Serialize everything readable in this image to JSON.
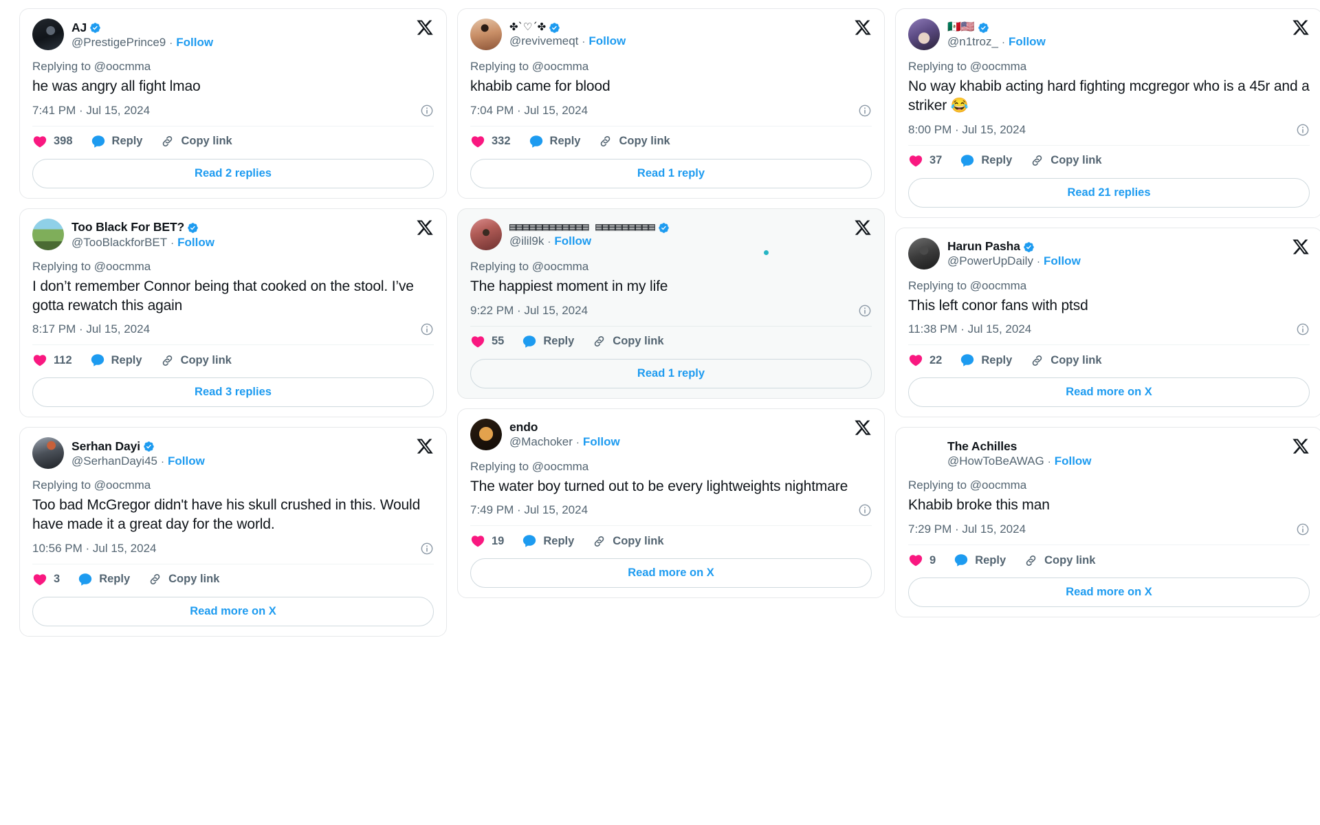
{
  "theme": {
    "accent_blue": "#1d9bf0",
    "like_pink": "#f91880",
    "reply_blue": "#1d9bf0",
    "text_primary": "#0f1419",
    "text_secondary": "#536471",
    "card_border": "#e6e8ea",
    "tinted_card_bg": "#f7f9f9",
    "verified_badge": "#1d9bf0"
  },
  "labels": {
    "replying_to": "Replying to @oocmma",
    "follow": "Follow",
    "reply": "Reply",
    "copy_link": "Copy link",
    "separator": "·"
  },
  "columns": [
    {
      "id": "column-1",
      "cards": [
        {
          "id": "card-prestigeprince9",
          "display_name": "AJ",
          "name_style": "plain",
          "verified": true,
          "has_avatar": true,
          "avatar_class": "av-aj",
          "handle": "@PrestigePrince9",
          "follow": "Follow",
          "replying_to": "Replying to @oocmma",
          "text": "he was angry all fight lmao",
          "timestamp": "7:41 PM · Jul 15, 2024",
          "likes": "398",
          "reply_label": "Reply",
          "copy_label": "Copy link",
          "read_button": "Read 2 replies",
          "tinted": false,
          "teal_dot": false
        },
        {
          "id": "card-tooblackforbet",
          "display_name": "Too Black For BET?",
          "name_style": "plain",
          "verified": true,
          "has_avatar": true,
          "avatar_class": "av-tbfb",
          "handle": "@TooBlackforBET",
          "follow": "Follow",
          "replying_to": "Replying to @oocmma",
          "text": "I don’t remember Connor being that cooked on the stool. I’ve gotta rewatch this again",
          "timestamp": "8:17 PM · Jul 15, 2024",
          "likes": "112",
          "reply_label": "Reply",
          "copy_label": "Copy link",
          "read_button": "Read 3 replies",
          "tinted": false,
          "teal_dot": false
        },
        {
          "id": "card-serhandayi45",
          "display_name": "Serhan Dayi",
          "name_style": "plain",
          "verified": true,
          "has_avatar": true,
          "avatar_class": "av-serhan",
          "handle": "@SerhanDayi45",
          "follow": "Follow",
          "replying_to": "Replying to @oocmma",
          "text": "Too bad McGregor didn't have his skull crushed in this. Would have made it a great day for the world.",
          "timestamp": "10:56 PM · Jul 15, 2024",
          "likes": "3",
          "reply_label": "Reply",
          "copy_label": "Copy link",
          "read_button": "Read more on X",
          "tinted": false,
          "teal_dot": false
        }
      ]
    },
    {
      "id": "column-2",
      "cards": [
        {
          "id": "card-revivemeqt",
          "display_name": "✤`♡´✤",
          "name_style": "symbols",
          "verified": true,
          "has_avatar": true,
          "avatar_class": "av-revive",
          "handle": "@revivemeqt",
          "follow": "Follow",
          "replying_to": "Replying to @oocmma",
          "text": "khabib came for blood",
          "timestamp": "7:04 PM · Jul 15, 2024",
          "likes": "332",
          "reply_label": "Reply",
          "copy_label": "Copy link",
          "read_button": "Read 1 reply",
          "tinted": false,
          "teal_dot": false
        },
        {
          "id": "card-ilil9k",
          "display_name": "▤▤▤▤▤▤▤▤▤▤▤▤ ▤▤▤▤▤▤▤▤▤",
          "name_style": "blocks",
          "verified": true,
          "has_avatar": true,
          "avatar_class": "av-ilil9k",
          "handle": "@ilil9k",
          "follow": "Follow",
          "replying_to": "Replying to @oocmma",
          "text": "The happiest moment in my life",
          "timestamp": "9:22 PM · Jul 15, 2024",
          "likes": "55",
          "reply_label": "Reply",
          "copy_label": "Copy link",
          "read_button": "Read 1 reply",
          "tinted": true,
          "teal_dot": true
        },
        {
          "id": "card-machoker",
          "display_name": "endo",
          "name_style": "plain",
          "verified": false,
          "has_avatar": true,
          "avatar_class": "av-endo",
          "handle": "@Machoker",
          "follow": "Follow",
          "replying_to": "Replying to @oocmma",
          "text": "The water boy turned out to be every lightweights nightmare",
          "timestamp": "7:49 PM · Jul 15, 2024",
          "likes": "19",
          "reply_label": "Reply",
          "copy_label": "Copy link",
          "read_button": "Read more on X",
          "tinted": false,
          "teal_dot": false
        }
      ]
    },
    {
      "id": "column-3",
      "cards": [
        {
          "id": "card-n1troz",
          "display_name": "🇲🇽🇺🇸",
          "name_style": "flags",
          "verified": true,
          "has_avatar": true,
          "avatar_class": "av-n1troz",
          "handle": "@n1troz_",
          "follow": "Follow",
          "replying_to": "Replying to @oocmma",
          "text": "No way khabib acting hard fighting mcgregor who is a 45r and a striker 😂",
          "timestamp": "8:00 PM · Jul 15, 2024",
          "likes": "37",
          "reply_label": "Reply",
          "copy_label": "Copy link",
          "read_button": "Read 21 replies",
          "tinted": false,
          "teal_dot": false
        },
        {
          "id": "card-powerupdaily",
          "display_name": "Harun Pasha",
          "name_style": "plain",
          "verified": true,
          "has_avatar": true,
          "avatar_class": "av-harun",
          "handle": "@PowerUpDaily",
          "follow": "Follow",
          "replying_to": "Replying to @oocmma",
          "text": "This left conor fans with ptsd",
          "timestamp": "11:38 PM · Jul 15, 2024",
          "likes": "22",
          "reply_label": "Reply",
          "copy_label": "Copy link",
          "read_button": "Read more on X",
          "tinted": false,
          "teal_dot": false
        },
        {
          "id": "card-howtobeawag",
          "display_name": "The Achilles",
          "name_style": "plain",
          "verified": false,
          "has_avatar": false,
          "avatar_class": "",
          "handle": "@HowToBeAWAG",
          "follow": "Follow",
          "replying_to": "Replying to @oocmma",
          "text": "Khabib broke this man",
          "timestamp": "7:29 PM · Jul 15, 2024",
          "likes": "9",
          "reply_label": "Reply",
          "copy_label": "Copy link",
          "read_button": "Read more on X",
          "tinted": false,
          "teal_dot": false
        }
      ]
    }
  ]
}
